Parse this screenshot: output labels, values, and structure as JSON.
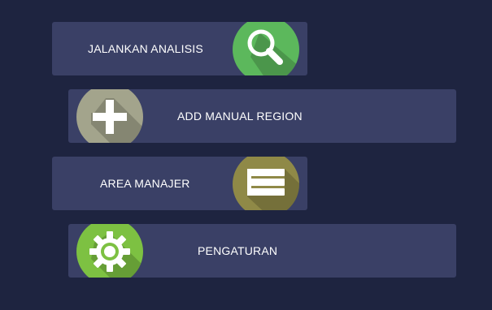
{
  "menu": {
    "analysis": {
      "label": "JALANKAN ANALISIS",
      "icon": "magnifier-icon",
      "color": "#5cb85c"
    },
    "add_region": {
      "label": "ADD MANUAL REGION",
      "icon": "plus-icon",
      "color": "#a3a48c"
    },
    "area_manager": {
      "label": "AREA MANAJER",
      "icon": "list-icon",
      "color": "#8f8947"
    },
    "settings": {
      "label": "PENGATURAN",
      "icon": "gear-icon",
      "color": "#7dc142"
    }
  },
  "colors": {
    "background": "#1e2440",
    "button": "#3a4066",
    "text": "#ffffff"
  }
}
